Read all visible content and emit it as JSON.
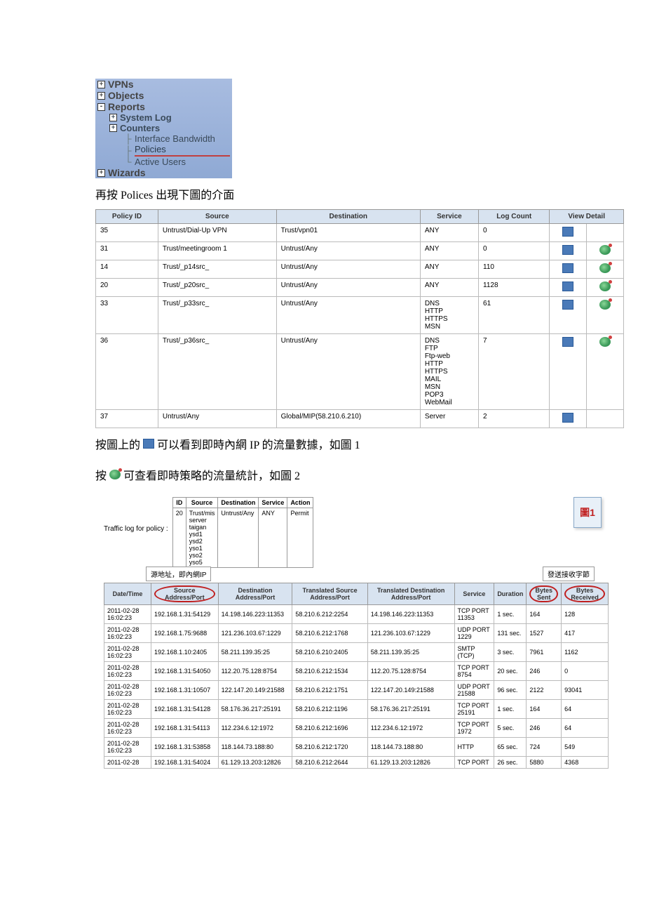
{
  "nav": {
    "vpns": "VPNs",
    "objects": "Objects",
    "reports": "Reports",
    "system_log": "System Log",
    "counters": "Counters",
    "interface_bandwidth": "Interface Bandwidth",
    "policies": "Policies",
    "active_users": "Active Users",
    "wizards": "Wizards"
  },
  "text": {
    "line1_a": "再按 Polices 出現下圖的介面",
    "line2_a": "按圖上的",
    "line2_b": "可以看到即時內網 IP 的流量數據，如圖 1",
    "line3_a": "按",
    "line3_b": "可查看即時策略的流量統計，如圖 2"
  },
  "policy_headers": [
    "Policy ID",
    "Source",
    "Destination",
    "Service",
    "Log Count",
    "View Detail"
  ],
  "policies": [
    {
      "id": "35",
      "src": "Untrust/Dial-Up VPN",
      "dst": "Trust/vpn01",
      "svc": "ANY",
      "cnt": "0",
      "d": true,
      "s": false
    },
    {
      "id": "31",
      "src": "Trust/meetingroom 1",
      "dst": "Untrust/Any",
      "svc": "ANY",
      "cnt": "0",
      "d": true,
      "s": true
    },
    {
      "id": "14",
      "src": "Trust/_p14src_",
      "dst": "Untrust/Any",
      "svc": "ANY",
      "cnt": "110",
      "d": true,
      "s": true
    },
    {
      "id": "20",
      "src": "Trust/_p20src_",
      "dst": "Untrust/Any",
      "svc": "ANY",
      "cnt": "1128",
      "d": true,
      "s": true
    },
    {
      "id": "33",
      "src": "Trust/_p33src_",
      "dst": "Untrust/Any",
      "svc": "DNS\nHTTP\nHTTPS\nMSN",
      "cnt": "61",
      "d": true,
      "s": true
    },
    {
      "id": "36",
      "src": "Trust/_p36src_",
      "dst": "Untrust/Any",
      "svc": "DNS\nFTP\nFtp-web\nHTTP\nHTTPS\nMAIL\nMSN\nPOP3\nWebMail",
      "cnt": "7",
      "d": true,
      "s": true
    },
    {
      "id": "37",
      "src": "Untrust/Any",
      "dst": "Global/MIP(58.210.6.210)",
      "svc": "Server",
      "cnt": "2",
      "d": true,
      "s": false
    }
  ],
  "traffic": {
    "label": "Traffic log for policy :",
    "mini_headers": [
      "ID",
      "Source",
      "Destination",
      "Service",
      "Action"
    ],
    "mini_row": {
      "id": "20",
      "src": "Trust/mis\nserver\ntaigan\nysd1\nysd2\nyso1\nyso2\nyso5",
      "dst": "Untrust/Any",
      "svc": "ANY",
      "act": "Permit"
    },
    "callout1": "圖1",
    "annot1": "源地址，即內網IP",
    "annot2": "發送接收字節"
  },
  "log_headers": [
    "Date/Time",
    "Source Address/Port",
    "Destination Address/Port",
    "Translated Source Address/Port",
    "Translated Destination Address/Port",
    "Service",
    "Duration",
    "Bytes Sent",
    "Bytes Received"
  ],
  "logs": [
    {
      "dt": "2011-02-28 16:02:23",
      "sa": "192.168.1.31:54129",
      "da": "14.198.146.223:11353",
      "tsa": "58.210.6.212:2254",
      "tda": "14.198.146.223:11353",
      "svc": "TCP PORT 11353",
      "dur": "1 sec.",
      "bs": "164",
      "br": "128"
    },
    {
      "dt": "2011-02-28 16:02:23",
      "sa": "192.168.1.75:9688",
      "da": "121.236.103.67:1229",
      "tsa": "58.210.6.212:1768",
      "tda": "121.236.103.67:1229",
      "svc": "UDP PORT 1229",
      "dur": "131 sec.",
      "bs": "1527",
      "br": "417"
    },
    {
      "dt": "2011-02-28 16:02:23",
      "sa": "192.168.1.10:2405",
      "da": "58.211.139.35:25",
      "tsa": "58.210.6.210:2405",
      "tda": "58.211.139.35:25",
      "svc": "SMTP (TCP)",
      "dur": "3 sec.",
      "bs": "7961",
      "br": "1162"
    },
    {
      "dt": "2011-02-28 16:02:23",
      "sa": "192.168.1.31:54050",
      "da": "112.20.75.128:8754",
      "tsa": "58.210.6.212:1534",
      "tda": "112.20.75.128:8754",
      "svc": "TCP PORT 8754",
      "dur": "20 sec.",
      "bs": "246",
      "br": "0"
    },
    {
      "dt": "2011-02-28 16:02:23",
      "sa": "192.168.1.31:10507",
      "da": "122.147.20.149:21588",
      "tsa": "58.210.6.212:1751",
      "tda": "122.147.20.149:21588",
      "svc": "UDP PORT 21588",
      "dur": "96 sec.",
      "bs": "2122",
      "br": "93041"
    },
    {
      "dt": "2011-02-28 16:02:23",
      "sa": "192.168.1.31:54128",
      "da": "58.176.36.217:25191",
      "tsa": "58.210.6.212:1196",
      "tda": "58.176.36.217:25191",
      "svc": "TCP PORT 25191",
      "dur": "1 sec.",
      "bs": "164",
      "br": "64"
    },
    {
      "dt": "2011-02-28 16:02:23",
      "sa": "192.168.1.31:54113",
      "da": "112.234.6.12:1972",
      "tsa": "58.210.6.212:1696",
      "tda": "112.234.6.12:1972",
      "svc": "TCP PORT 1972",
      "dur": "5 sec.",
      "bs": "246",
      "br": "64"
    },
    {
      "dt": "2011-02-28 16:02:23",
      "sa": "192.168.1.31:53858",
      "da": "118.144.73.188:80",
      "tsa": "58.210.6.212:1720",
      "tda": "118.144.73.188:80",
      "svc": "HTTP",
      "dur": "65 sec.",
      "bs": "724",
      "br": "549"
    },
    {
      "dt": "2011-02-28",
      "sa": "192.168.1.31:54024",
      "da": "61.129.13.203:12826",
      "tsa": "58.210.6.212:2644",
      "tda": "61.129.13.203:12826",
      "svc": "TCP PORT",
      "dur": "26 sec.",
      "bs": "5880",
      "br": "4368"
    }
  ]
}
